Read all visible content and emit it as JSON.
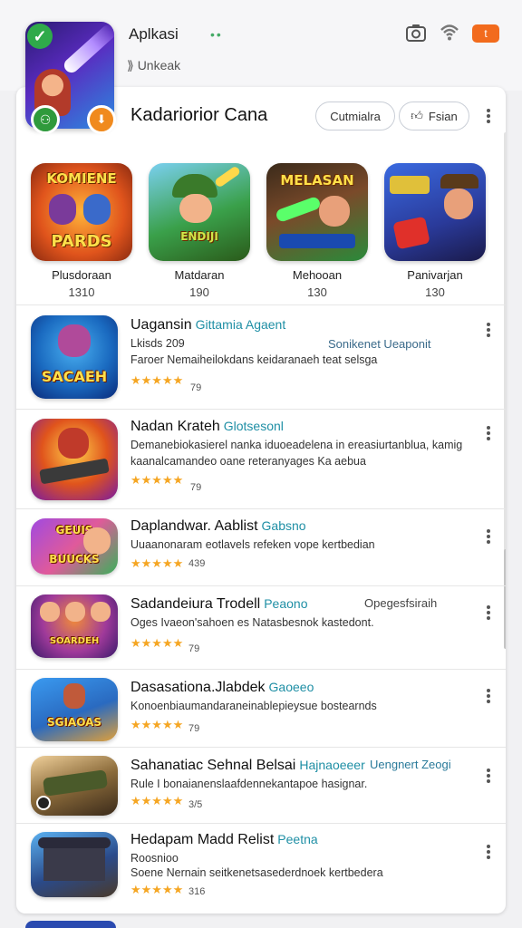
{
  "header": {
    "title": "Aplkasi",
    "subtitle": "Unkeak",
    "battery_label": "t"
  },
  "card": {
    "title": "Kadariorior Cana",
    "pill_1": "Cutmialra",
    "pill_2": "Fsian"
  },
  "featured": [
    {
      "name": "Plusdoraan",
      "num": "1310",
      "art": "KOMIENE PARDS"
    },
    {
      "name": "Matdaran",
      "num": "190",
      "art": "ENDIJI"
    },
    {
      "name": "Mehooan",
      "num": "130",
      "art": "MELASAN"
    },
    {
      "name": "Panivarjan",
      "num": "130",
      "art": ""
    }
  ],
  "list": [
    {
      "title": "Uagansin",
      "tag": "Gittamia Agaent",
      "extra": "Sonikenet Ueaponit",
      "desc": [
        "Lkisds 209",
        "Faroer Nemaiheilokdans keidaranaeh teat selsga"
      ],
      "rating": "79",
      "art": "SACAEH"
    },
    {
      "title": "Nadan Krateh",
      "tag": "Glotsesonl",
      "extra": "",
      "desc": [
        "Demanebiokasierel nanka iduoeadelena in ereasiurtanblua, kamig",
        "kaanalcamandeo oane reteranyages Ka aebua"
      ],
      "rating": "79",
      "art": ""
    },
    {
      "title": "Daplandwar. Aablist",
      "tag": "Gabsno",
      "extra": "",
      "desc": [
        "Uuaanonaram eotlavels refeken vope kertbedian"
      ],
      "rating": "439",
      "art": "GEUIS"
    },
    {
      "title": "Sadandeiura Trodell",
      "tag": "Peaono",
      "extra": "Opegesfsiraih",
      "desc": [
        "Oges Ivaeon'sahoen es Natasbesnok kastedont."
      ],
      "rating": "79",
      "art": "SOARDEH"
    },
    {
      "title": "Dasasationa.Jlabdek",
      "tag": "Gaoeeo",
      "extra": "",
      "desc": [
        "Konoenbiaumandaraneinablepieysue bostearnds"
      ],
      "rating": "79",
      "art": "SGIAOAS"
    },
    {
      "title": "Sahanatiac Sehnal Belsai",
      "tag": "Hajnaoeeer",
      "extra": "Uengnert Zeogi",
      "desc": [
        "Rule I bonaianenslaafdennekantapoe hasignar."
      ],
      "rating": "3/5",
      "art": ""
    },
    {
      "title": "Hedapam Madd Relist",
      "tag": "Peetna",
      "extra": "",
      "desc": [
        "Roosnioo",
        "Soene Nernain seitkenetsasederdnoek kertbedera"
      ],
      "rating": "316",
      "art": ""
    }
  ],
  "colors": {
    "accent": "#1f8fa5",
    "star": "#f5a623",
    "battery": "#f26b1d"
  }
}
